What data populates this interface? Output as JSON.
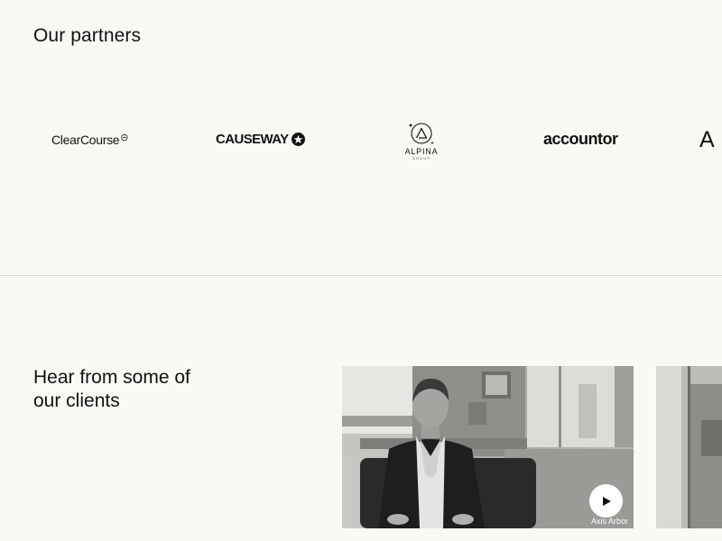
{
  "partners": {
    "title": "Our partners",
    "logos": [
      {
        "name": "ClearCourse",
        "text": "ClearCourse"
      },
      {
        "name": "Causeway",
        "text": "CAUSEWAY"
      },
      {
        "name": "Alpina Group",
        "text": "ALPINA",
        "subtext": "GROUP"
      },
      {
        "name": "Accountor",
        "text": "accountor"
      },
      {
        "name": "cut-off partner",
        "text": "A I"
      }
    ]
  },
  "clients": {
    "title": "Hear from some of our clients",
    "videos": [
      {
        "caption": "Axis Arbor",
        "icon": "play-icon"
      },
      {
        "caption": ""
      }
    ]
  },
  "colors": {
    "background": "#fafaf5",
    "text": "#111111",
    "divider": "#d8d8d2"
  }
}
